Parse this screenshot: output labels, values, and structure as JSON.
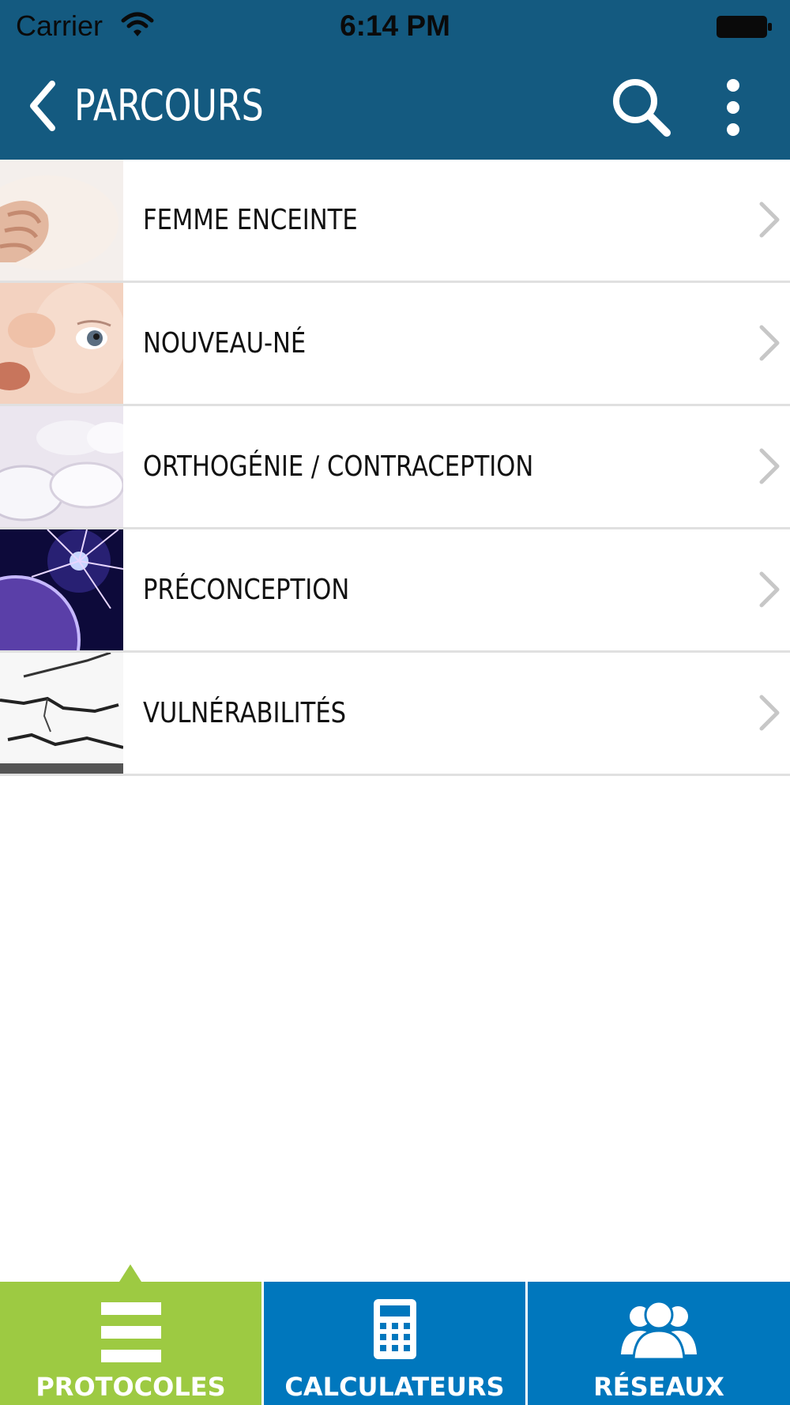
{
  "status_bar": {
    "carrier": "Carrier",
    "time": "6:14 PM"
  },
  "nav": {
    "title": "PARCOURS"
  },
  "colors": {
    "nav_bg": "#145a80",
    "tab_active": "#9dca42",
    "tab_inactive": "#0077bd"
  },
  "list": {
    "items": [
      {
        "label": "FEMME ENCEINTE",
        "icon": "pregnant-belly-thumbnail"
      },
      {
        "label": "NOUVEAU-NÉ",
        "icon": "newborn-thumbnail"
      },
      {
        "label": "ORTHOGÉNIE / CONTRACEPTION",
        "icon": "pills-thumbnail"
      },
      {
        "label": "PRÉCONCEPTION",
        "icon": "sperm-egg-thumbnail"
      },
      {
        "label": "VULNÉRABILITÉS",
        "icon": "cracked-surface-thumbnail"
      }
    ]
  },
  "tabs": [
    {
      "label": "PROTOCOLES",
      "icon": "hamburger-icon",
      "active": true
    },
    {
      "label": "CALCULATEURS",
      "icon": "calculator-icon",
      "active": false
    },
    {
      "label": "RÉSEAUX",
      "icon": "people-icon",
      "active": false
    }
  ]
}
